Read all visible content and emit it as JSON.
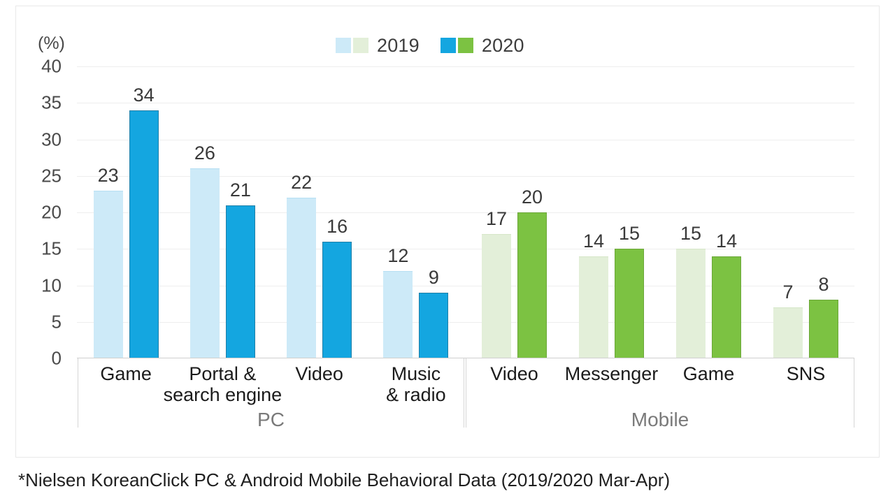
{
  "footnote": "*Nielsen KoreanClick PC & Android Mobile Behavioral Data (2019/2020 Mar-Apr)",
  "legend": {
    "entries": [
      {
        "label": "2019",
        "swatch_pc": "#cdeaf8",
        "swatch_mobile": "#e3efd9"
      },
      {
        "label": "2020",
        "swatch_pc": "#14a6e0",
        "swatch_mobile": "#7cc242"
      }
    ]
  },
  "colors": {
    "pc_2019": "#cdeaf8",
    "pc_2020": "#14a6e0",
    "mobile_2019": "#e3efd9",
    "mobile_2020": "#7cc242",
    "gridline": "#eeeeee",
    "axis": "#cfcfcf",
    "label_text": "#1b1b1b",
    "group_text": "#7a7a7a",
    "value_text": "#3a3a3a"
  },
  "chart_data": {
    "type": "bar",
    "title": "",
    "subtitle": "",
    "xlabel": "",
    "ylabel": "(%)",
    "ylim": [
      0,
      40
    ],
    "yticks": [
      0,
      5,
      10,
      15,
      20,
      25,
      30,
      35,
      40
    ],
    "ytick_labels": [
      "0",
      "5",
      "10",
      "15",
      "20",
      "25",
      "30",
      "35",
      "40"
    ],
    "grid": true,
    "legend_position": "top-center",
    "legend_entries": [
      "2019",
      "2020"
    ],
    "series": [
      {
        "name": "2019",
        "values": [
          23,
          26,
          22,
          12,
          17,
          14,
          15,
          7
        ]
      },
      {
        "name": "2020",
        "values": [
          34,
          21,
          16,
          9,
          20,
          15,
          14,
          8
        ]
      }
    ],
    "categories": [
      "Game",
      "Portal & search engine",
      "Video",
      "Music & radio",
      "Video",
      "Messenger",
      "Game",
      "SNS"
    ],
    "groups": [
      {
        "name": "PC",
        "categories": [
          {
            "line1": "Game",
            "line2": "",
            "v2019": 23,
            "v2020": 34
          },
          {
            "line1": "Portal &",
            "line2": "search engine",
            "v2019": 26,
            "v2020": 21
          },
          {
            "line1": "Video",
            "line2": "",
            "v2019": 22,
            "v2020": 16
          },
          {
            "line1": "Music",
            "line2": "& radio",
            "v2019": 12,
            "v2020": 9
          }
        ]
      },
      {
        "name": "Mobile",
        "categories": [
          {
            "line1": "Video",
            "line2": "",
            "v2019": 17,
            "v2020": 20
          },
          {
            "line1": "Messenger",
            "line2": "",
            "v2019": 14,
            "v2020": 15
          },
          {
            "line1": "Game",
            "line2": "",
            "v2019": 15,
            "v2020": 14
          },
          {
            "line1": "SNS",
            "line2": "",
            "v2019": 7,
            "v2020": 8
          }
        ]
      }
    ]
  }
}
